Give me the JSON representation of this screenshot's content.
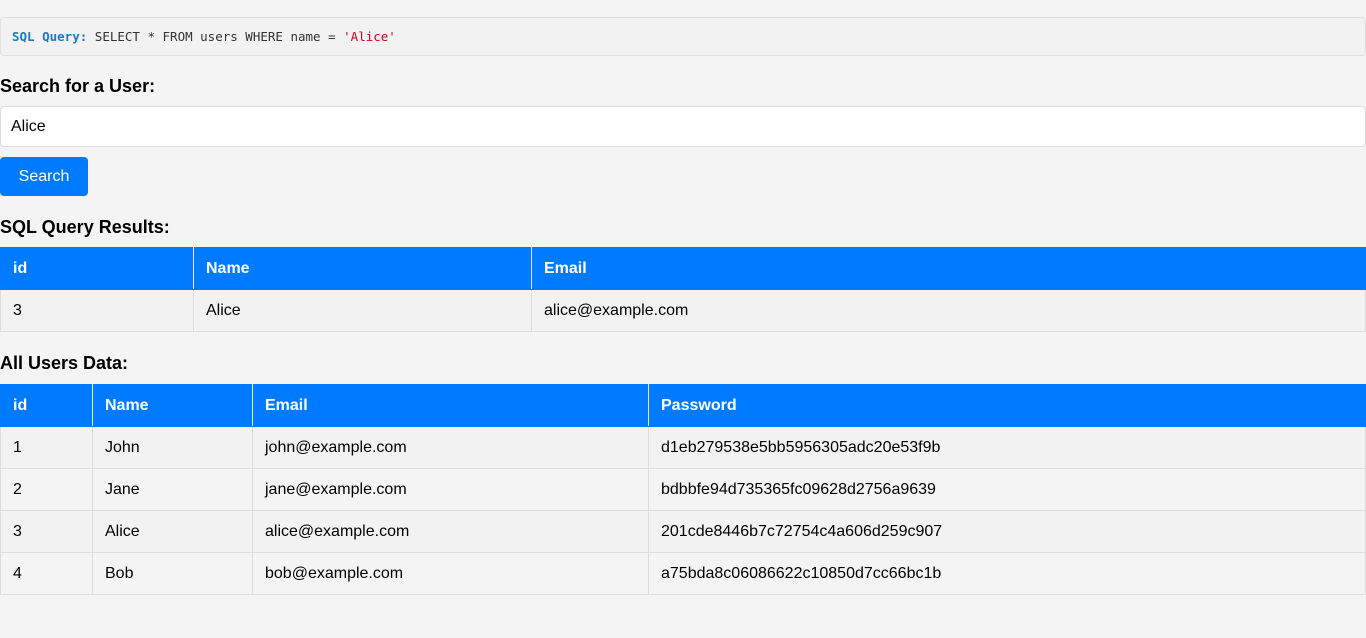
{
  "query": {
    "label": "SQL Query:",
    "prefix": " SELECT * FROM users WHERE name = ",
    "value": "'Alice'"
  },
  "search": {
    "heading": "Search for a User:",
    "value": "Alice",
    "button_label": "Search"
  },
  "results": {
    "heading": "SQL Query Results:",
    "columns": [
      "id",
      "Name",
      "Email"
    ],
    "rows": [
      [
        "3",
        "Alice",
        "alice@example.com"
      ]
    ]
  },
  "all_users": {
    "heading": "All Users Data:",
    "columns": [
      "id",
      "Name",
      "Email",
      "Password"
    ],
    "rows": [
      [
        "1",
        "John",
        "john@example.com",
        "d1eb279538e5bb5956305adc20e53f9b"
      ],
      [
        "2",
        "Jane",
        "jane@example.com",
        "bdbbfe94d735365fc09628d2756a9639"
      ],
      [
        "3",
        "Alice",
        "alice@example.com",
        "201cde8446b7c72754c4a606d259c907"
      ],
      [
        "4",
        "Bob",
        "bob@example.com",
        "a75bda8c06086622c10850d7cc66bc1b"
      ]
    ]
  },
  "colors": {
    "accent": "#007bff",
    "query_label": "#1a7ac7",
    "query_value": "#d0021b",
    "background": "#f4f4f4"
  }
}
